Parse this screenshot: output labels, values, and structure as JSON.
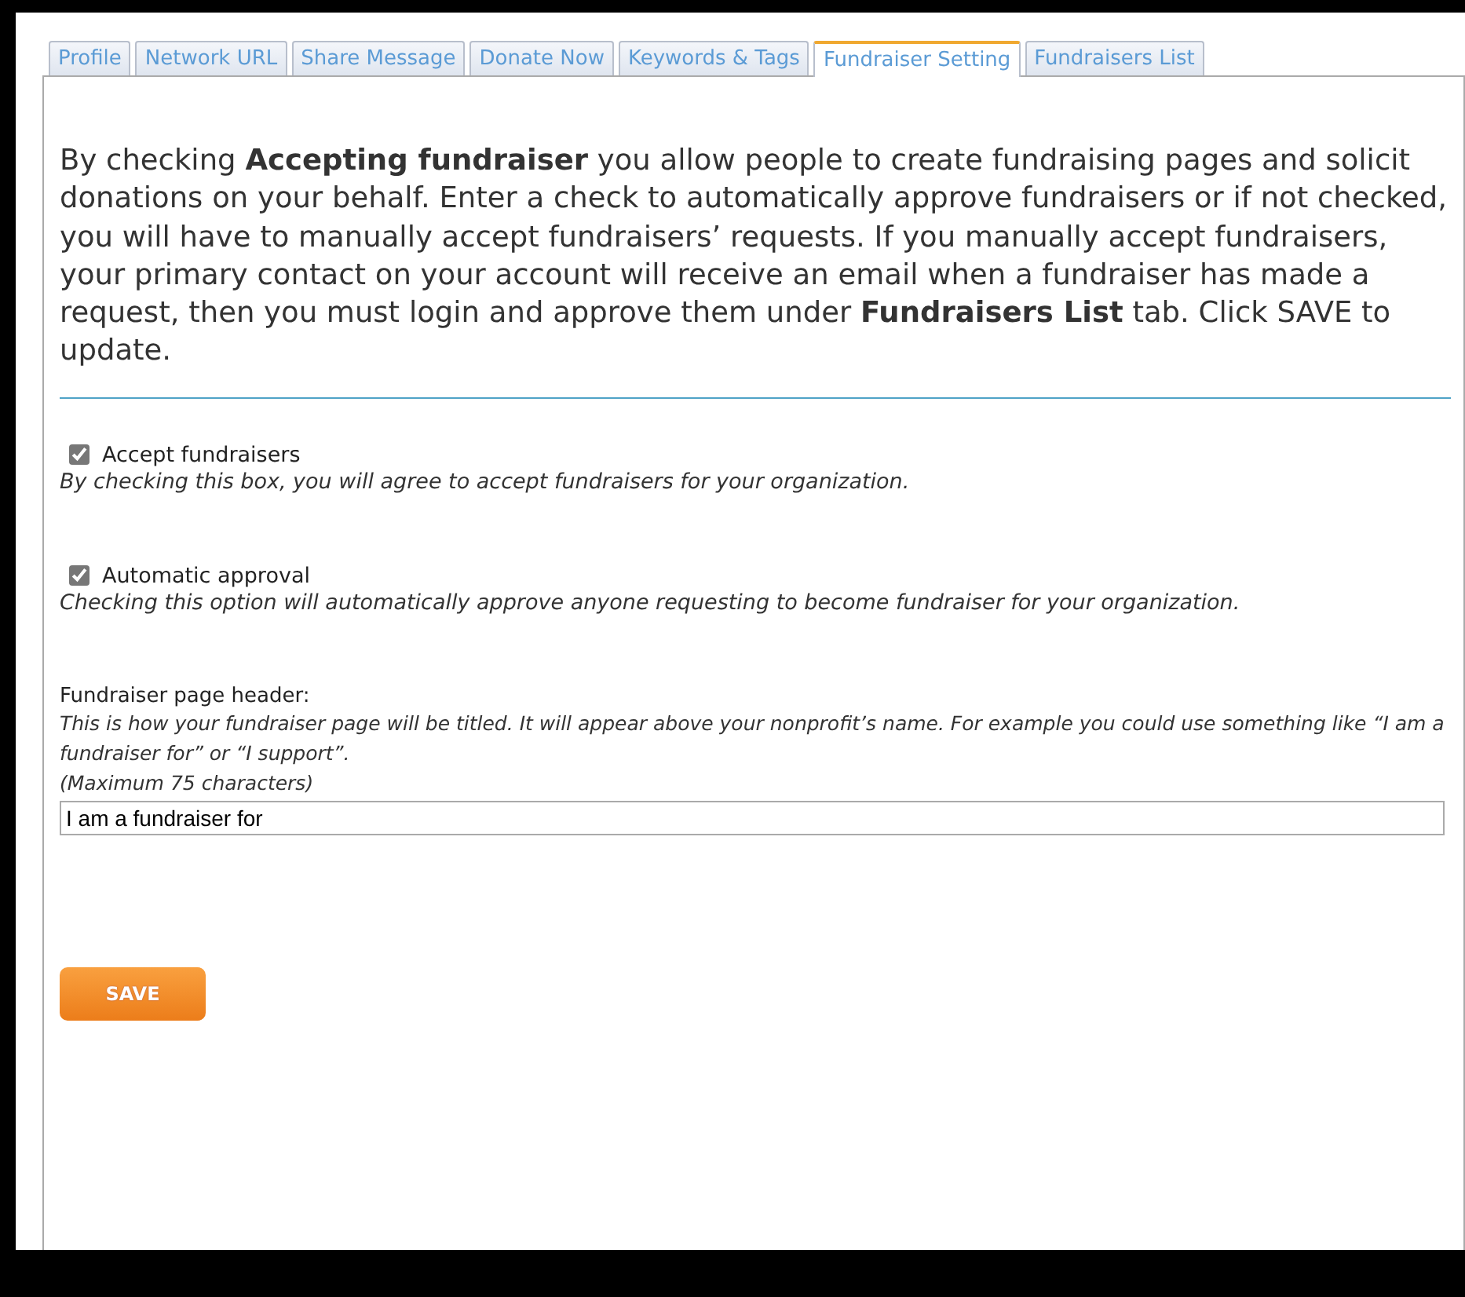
{
  "tabs": [
    {
      "label": "Profile",
      "selected": false
    },
    {
      "label": "Network URL",
      "selected": false
    },
    {
      "label": "Share Message",
      "selected": false
    },
    {
      "label": "Donate Now",
      "selected": false
    },
    {
      "label": "Keywords & Tags",
      "selected": false
    },
    {
      "label": "Fundraiser Setting",
      "selected": true
    },
    {
      "label": "Fundraisers List",
      "selected": false
    }
  ],
  "intro": "By checking **Accepting fundraiser** you allow people to create fundraising pages and solicit donations on your behalf. Enter a check to automatically approve fundraisers or if not checked, you will have to manually accept fundraisers’ requests. If you manually accept fundraisers, your primary contact on your account will receive an email when a fundraiser has made a request, then you must login and approve them under **Fundraisers List** tab. Click SAVE to update.",
  "options": [
    {
      "label": "Accept fundraisers",
      "checked": true,
      "description": "By checking this box, you will agree to accept fundraisers for your organization."
    },
    {
      "label": "Automatic approval",
      "checked": true,
      "description": "Checking this option will automatically approve anyone requesting to become fundraiser for your organization."
    }
  ],
  "header_field": {
    "label": "Fundraiser page header:",
    "hint": "This is how your fundraiser page will be titled. It will appear above your nonprofit’s name. For example you could use something like “I am a fundraiser for” or “I support”.",
    "limit": "(Maximum 75 characters)",
    "value": "I am a fundraiser for"
  },
  "save_button": "SAVE"
}
